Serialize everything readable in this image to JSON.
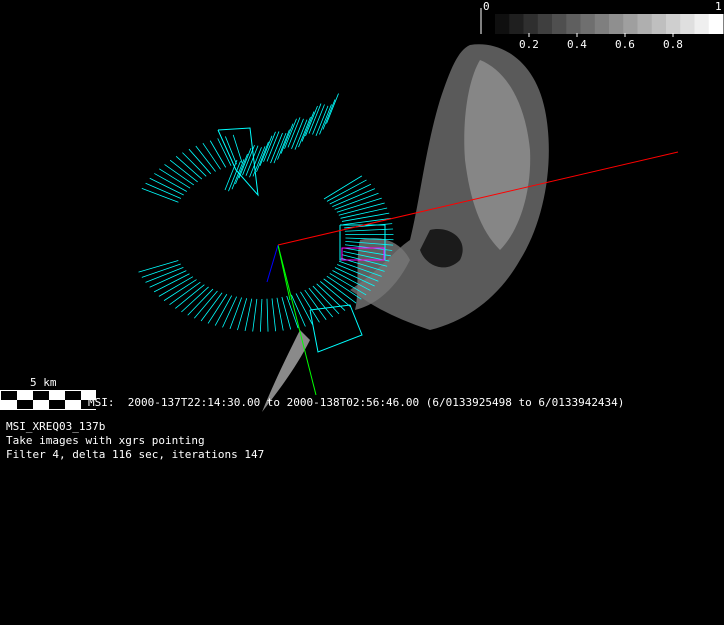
{
  "colorbar": {
    "min_label": "0",
    "max_label": "1",
    "ticks": [
      "0.2",
      "0.4",
      "0.6",
      "0.8"
    ],
    "steps": 16
  },
  "scale_bar": {
    "label": "5 km"
  },
  "observation": {
    "time_range": "MSI:  2000-137T22:14:30.00 to 2000-138T02:56:46.00 (6/0133925498 to 6/0133942434)",
    "request_id": "MSI_XREQ03_137b",
    "description": "Take images with xgrs pointing",
    "parameters": "Filter 4, delta 116 sec, iterations 147"
  },
  "colors": {
    "swath": "#00ffff",
    "boresight": "#ff0000",
    "axis_green": "#00ff00",
    "axis_blue": "#0000ff",
    "asteroid": "#888888"
  }
}
